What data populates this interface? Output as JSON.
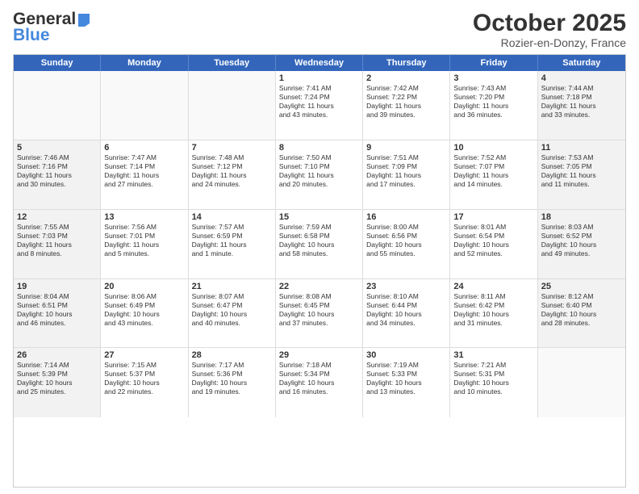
{
  "header": {
    "logo_general": "General",
    "logo_blue": "Blue",
    "month_title": "October 2025",
    "location": "Rozier-en-Donzy, France"
  },
  "days_of_week": [
    "Sunday",
    "Monday",
    "Tuesday",
    "Wednesday",
    "Thursday",
    "Friday",
    "Saturday"
  ],
  "weeks": [
    [
      {
        "day": "",
        "empty": true
      },
      {
        "day": "",
        "empty": true
      },
      {
        "day": "",
        "empty": true
      },
      {
        "day": "1",
        "line1": "Sunrise: 7:41 AM",
        "line2": "Sunset: 7:24 PM",
        "line3": "Daylight: 11 hours",
        "line4": "and 43 minutes."
      },
      {
        "day": "2",
        "line1": "Sunrise: 7:42 AM",
        "line2": "Sunset: 7:22 PM",
        "line3": "Daylight: 11 hours",
        "line4": "and 39 minutes."
      },
      {
        "day": "3",
        "line1": "Sunrise: 7:43 AM",
        "line2": "Sunset: 7:20 PM",
        "line3": "Daylight: 11 hours",
        "line4": "and 36 minutes."
      },
      {
        "day": "4",
        "line1": "Sunrise: 7:44 AM",
        "line2": "Sunset: 7:18 PM",
        "line3": "Daylight: 11 hours",
        "line4": "and 33 minutes."
      }
    ],
    [
      {
        "day": "5",
        "line1": "Sunrise: 7:46 AM",
        "line2": "Sunset: 7:16 PM",
        "line3": "Daylight: 11 hours",
        "line4": "and 30 minutes."
      },
      {
        "day": "6",
        "line1": "Sunrise: 7:47 AM",
        "line2": "Sunset: 7:14 PM",
        "line3": "Daylight: 11 hours",
        "line4": "and 27 minutes."
      },
      {
        "day": "7",
        "line1": "Sunrise: 7:48 AM",
        "line2": "Sunset: 7:12 PM",
        "line3": "Daylight: 11 hours",
        "line4": "and 24 minutes."
      },
      {
        "day": "8",
        "line1": "Sunrise: 7:50 AM",
        "line2": "Sunset: 7:10 PM",
        "line3": "Daylight: 11 hours",
        "line4": "and 20 minutes."
      },
      {
        "day": "9",
        "line1": "Sunrise: 7:51 AM",
        "line2": "Sunset: 7:09 PM",
        "line3": "Daylight: 11 hours",
        "line4": "and 17 minutes."
      },
      {
        "day": "10",
        "line1": "Sunrise: 7:52 AM",
        "line2": "Sunset: 7:07 PM",
        "line3": "Daylight: 11 hours",
        "line4": "and 14 minutes."
      },
      {
        "day": "11",
        "line1": "Sunrise: 7:53 AM",
        "line2": "Sunset: 7:05 PM",
        "line3": "Daylight: 11 hours",
        "line4": "and 11 minutes."
      }
    ],
    [
      {
        "day": "12",
        "line1": "Sunrise: 7:55 AM",
        "line2": "Sunset: 7:03 PM",
        "line3": "Daylight: 11 hours",
        "line4": "and 8 minutes."
      },
      {
        "day": "13",
        "line1": "Sunrise: 7:56 AM",
        "line2": "Sunset: 7:01 PM",
        "line3": "Daylight: 11 hours",
        "line4": "and 5 minutes."
      },
      {
        "day": "14",
        "line1": "Sunrise: 7:57 AM",
        "line2": "Sunset: 6:59 PM",
        "line3": "Daylight: 11 hours",
        "line4": "and 1 minute."
      },
      {
        "day": "15",
        "line1": "Sunrise: 7:59 AM",
        "line2": "Sunset: 6:58 PM",
        "line3": "Daylight: 10 hours",
        "line4": "and 58 minutes."
      },
      {
        "day": "16",
        "line1": "Sunrise: 8:00 AM",
        "line2": "Sunset: 6:56 PM",
        "line3": "Daylight: 10 hours",
        "line4": "and 55 minutes."
      },
      {
        "day": "17",
        "line1": "Sunrise: 8:01 AM",
        "line2": "Sunset: 6:54 PM",
        "line3": "Daylight: 10 hours",
        "line4": "and 52 minutes."
      },
      {
        "day": "18",
        "line1": "Sunrise: 8:03 AM",
        "line2": "Sunset: 6:52 PM",
        "line3": "Daylight: 10 hours",
        "line4": "and 49 minutes."
      }
    ],
    [
      {
        "day": "19",
        "line1": "Sunrise: 8:04 AM",
        "line2": "Sunset: 6:51 PM",
        "line3": "Daylight: 10 hours",
        "line4": "and 46 minutes."
      },
      {
        "day": "20",
        "line1": "Sunrise: 8:06 AM",
        "line2": "Sunset: 6:49 PM",
        "line3": "Daylight: 10 hours",
        "line4": "and 43 minutes."
      },
      {
        "day": "21",
        "line1": "Sunrise: 8:07 AM",
        "line2": "Sunset: 6:47 PM",
        "line3": "Daylight: 10 hours",
        "line4": "and 40 minutes."
      },
      {
        "day": "22",
        "line1": "Sunrise: 8:08 AM",
        "line2": "Sunset: 6:45 PM",
        "line3": "Daylight: 10 hours",
        "line4": "and 37 minutes."
      },
      {
        "day": "23",
        "line1": "Sunrise: 8:10 AM",
        "line2": "Sunset: 6:44 PM",
        "line3": "Daylight: 10 hours",
        "line4": "and 34 minutes."
      },
      {
        "day": "24",
        "line1": "Sunrise: 8:11 AM",
        "line2": "Sunset: 6:42 PM",
        "line3": "Daylight: 10 hours",
        "line4": "and 31 minutes."
      },
      {
        "day": "25",
        "line1": "Sunrise: 8:12 AM",
        "line2": "Sunset: 6:40 PM",
        "line3": "Daylight: 10 hours",
        "line4": "and 28 minutes."
      }
    ],
    [
      {
        "day": "26",
        "line1": "Sunrise: 7:14 AM",
        "line2": "Sunset: 5:39 PM",
        "line3": "Daylight: 10 hours",
        "line4": "and 25 minutes."
      },
      {
        "day": "27",
        "line1": "Sunrise: 7:15 AM",
        "line2": "Sunset: 5:37 PM",
        "line3": "Daylight: 10 hours",
        "line4": "and 22 minutes."
      },
      {
        "day": "28",
        "line1": "Sunrise: 7:17 AM",
        "line2": "Sunset: 5:36 PM",
        "line3": "Daylight: 10 hours",
        "line4": "and 19 minutes."
      },
      {
        "day": "29",
        "line1": "Sunrise: 7:18 AM",
        "line2": "Sunset: 5:34 PM",
        "line3": "Daylight: 10 hours",
        "line4": "and 16 minutes."
      },
      {
        "day": "30",
        "line1": "Sunrise: 7:19 AM",
        "line2": "Sunset: 5:33 PM",
        "line3": "Daylight: 10 hours",
        "line4": "and 13 minutes."
      },
      {
        "day": "31",
        "line1": "Sunrise: 7:21 AM",
        "line2": "Sunset: 5:31 PM",
        "line3": "Daylight: 10 hours",
        "line4": "and 10 minutes."
      },
      {
        "day": "",
        "empty": true
      }
    ]
  ]
}
